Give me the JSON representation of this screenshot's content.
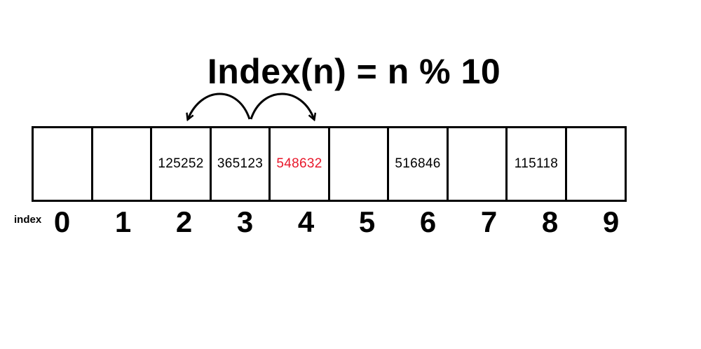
{
  "title": "Index(n) = n % 10",
  "index_label": "index",
  "colors": {
    "text": "#000000",
    "highlight": "#e8192c"
  },
  "cells": [
    {
      "index": "0",
      "value": "",
      "highlight": false
    },
    {
      "index": "1",
      "value": "",
      "highlight": false
    },
    {
      "index": "2",
      "value": "125252",
      "highlight": false
    },
    {
      "index": "3",
      "value": "365123",
      "highlight": false
    },
    {
      "index": "4",
      "value": "548632",
      "highlight": true
    },
    {
      "index": "5",
      "value": "",
      "highlight": false
    },
    {
      "index": "6",
      "value": "516846",
      "highlight": false
    },
    {
      "index": "7",
      "value": "",
      "highlight": false
    },
    {
      "index": "8",
      "value": "115118",
      "highlight": false
    },
    {
      "index": "9",
      "value": "",
      "highlight": false
    }
  ]
}
